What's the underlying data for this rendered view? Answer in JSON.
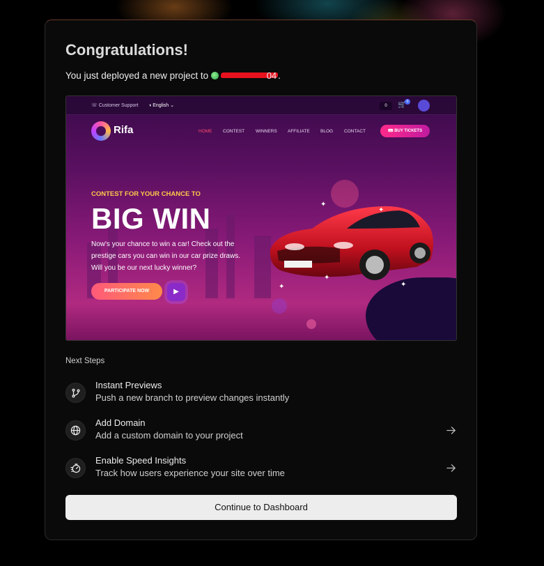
{
  "header": {
    "title": "Congratulations!",
    "subtitle_prefix": "You just deployed a new project to",
    "project_suffix": "04",
    "period": "."
  },
  "preview": {
    "topbar": {
      "support": "Customer Support",
      "language": "English",
      "cart_count": "0",
      "cart_badge": "0"
    },
    "logo_text": "Rifa",
    "nav": [
      "HOME",
      "CONTEST",
      "WINNERS",
      "AFFILIATE",
      "BLOG",
      "CONTACT"
    ],
    "buy_tickets": "BUY TICKETS",
    "kicker": "CONTEST FOR YOUR CHANCE TO",
    "headline": "BIG WIN",
    "body": "Now's your chance to win a car! Check out the prestige cars you can win in our car prize draws. Will you be our next lucky winner?",
    "participate": "PARTICIPATE NOW"
  },
  "next_steps": {
    "label": "Next Steps",
    "items": [
      {
        "title": "Instant Previews",
        "desc": "Push a new branch to preview changes instantly",
        "icon": "git-branch-icon",
        "has_arrow": false
      },
      {
        "title": "Add Domain",
        "desc": "Add a custom domain to your project",
        "icon": "globe-icon",
        "has_arrow": true
      },
      {
        "title": "Enable Speed Insights",
        "desc": "Track how users experience your site over time",
        "icon": "speed-gauge-icon",
        "has_arrow": true
      }
    ]
  },
  "continue_button": "Continue to Dashboard",
  "colors": {
    "background": "#000000",
    "card": "#0a0a0a",
    "button": "#ededed",
    "accent_status": "#2aa04a"
  }
}
